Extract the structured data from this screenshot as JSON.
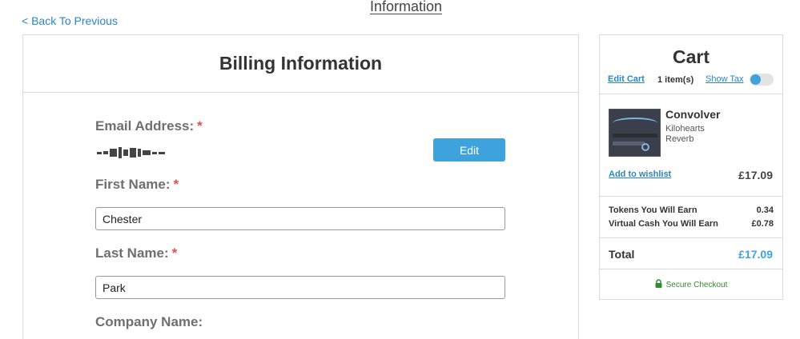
{
  "header": {
    "title": "Information",
    "back_link": "< Back To Previous"
  },
  "billing": {
    "title": "Billing Information",
    "email_label": "Email Address:",
    "first_name_label": "First Name:",
    "first_name_value": "Chester",
    "last_name_label": "Last Name:",
    "last_name_value": "Park",
    "company_label": "Company Name:",
    "required_mark": "*",
    "edit_button": "Edit"
  },
  "cart": {
    "title": "Cart",
    "edit_cart": "Edit Cart",
    "item_count": "1 item(s)",
    "show_tax": "Show Tax",
    "product": {
      "name": "Convolver",
      "brand": "Kilohearts",
      "category": "Reverb",
      "price": "£17.09"
    },
    "wishlist": "Add to wishlist",
    "tokens_label": "Tokens You Will Earn",
    "tokens_value": "0.34",
    "cash_label": "Virtual Cash You Will Earn",
    "cash_value": "£0.78",
    "total_label": "Total",
    "total_value": "£17.09",
    "secure_checkout": "Secure Checkout"
  },
  "colors": {
    "accent": "#3ea3dc",
    "link": "#2a86c7",
    "required": "#d9534f",
    "secure": "#2e8b2e"
  },
  "icons": {
    "secure": "lock-icon",
    "product": "convolver-thumbnail"
  }
}
